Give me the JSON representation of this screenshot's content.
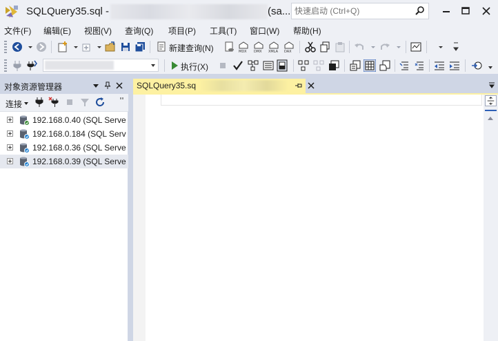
{
  "window": {
    "title": "SQLQuery35.sql -",
    "title_suffix": "(sa...",
    "quick_launch_placeholder": "快速启动 (Ctrl+Q)"
  },
  "menu": [
    "文件(F)",
    "编辑(E)",
    "视图(V)",
    "查询(Q)",
    "项目(P)",
    "工具(T)",
    "窗口(W)",
    "帮助(H)"
  ],
  "toolbar": {
    "new_query_label": "新建查询(N)",
    "execute_label": "执行(X)"
  },
  "object_explorer": {
    "title": "对象资源管理器",
    "connect_label": "连接",
    "servers": [
      {
        "label": "192.168.0.40 (SQL Serve"
      },
      {
        "label": "192.168.0.184 (SQL Serv"
      },
      {
        "label": "192.168.0.36 (SQL Serve"
      },
      {
        "label": "192.168.0.39 (SQL Serve"
      }
    ]
  },
  "editor": {
    "tab_label": "SQLQuery35.sq",
    "content": ""
  },
  "colors": {
    "accent": "#2d5fb7",
    "tab_active": "#fdf1a2",
    "chrome": "#eef0f5",
    "frame": "#cfd6e5"
  }
}
